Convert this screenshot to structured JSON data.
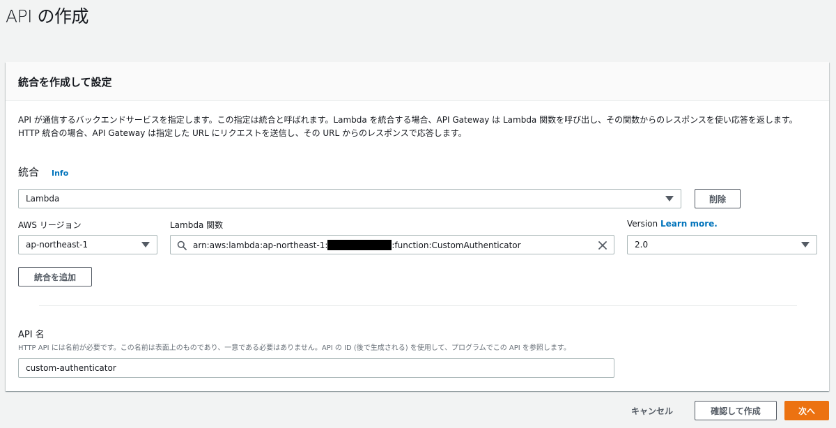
{
  "page": {
    "title": "API の作成"
  },
  "panel": {
    "title": "統合を作成して設定",
    "description": "API が通信するバックエンドサービスを指定します。この指定は統合と呼ばれます。Lambda を統合する場合、API Gateway は Lambda 関数を呼び出し、その関数からのレスポンスを使い応答を返します。HTTP 統合の場合、API Gateway は指定した URL にリクエストを送信し、その URL からのレスポンスで応答します。"
  },
  "integration": {
    "label": "統合",
    "info": "Info",
    "type_value": "Lambda",
    "remove_label": "削除",
    "region_label": "AWS リージョン",
    "region_value": "ap-northeast-1",
    "function_label": "Lambda 関数",
    "function_prefix": "arn:aws:lambda:ap-northeast-1:",
    "function_suffix": ":function:CustomAuthenticator",
    "version_label": "Version",
    "version_link": "Learn more.",
    "version_value": "2.0",
    "add_label": "統合を追加"
  },
  "api_name": {
    "label": "API 名",
    "hint": "HTTP API には名前が必要です。この名前は表面上のものであり、一意である必要はありません。API の ID (後で生成される) を使用して、プログラムでこの API を参照します。",
    "value": "custom-authenticator"
  },
  "footer": {
    "cancel_label": "キャンセル",
    "review_label": "確認して作成",
    "next_label": "次へ"
  },
  "colors": {
    "accent": "#ec7211",
    "link": "#0073bb"
  },
  "icons": [
    "search-icon",
    "clear-icon",
    "caret-down-icon"
  ]
}
